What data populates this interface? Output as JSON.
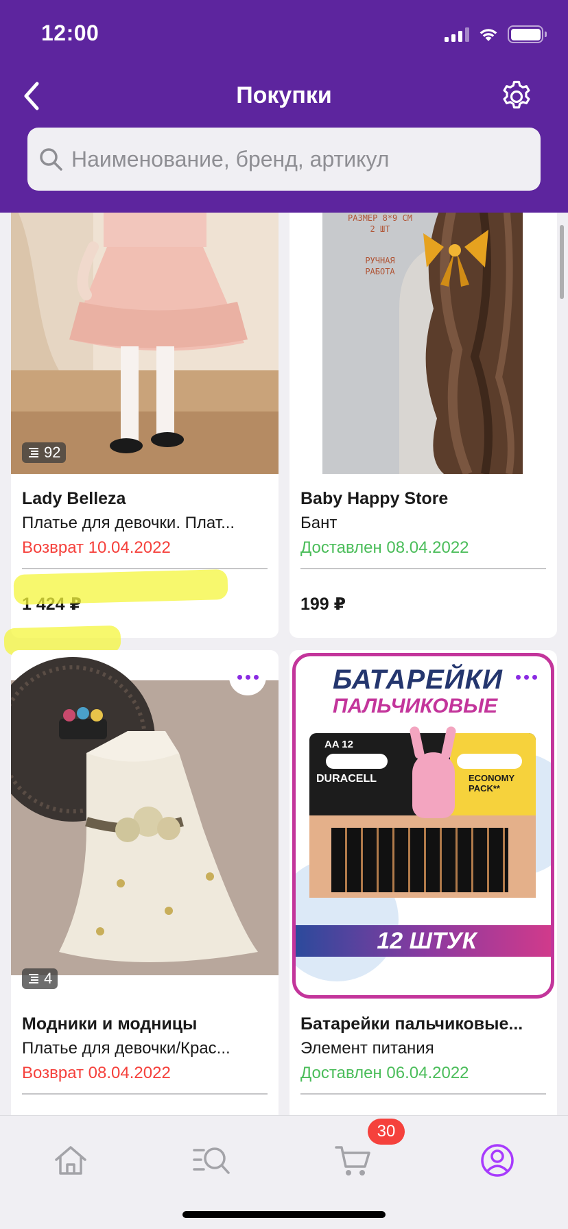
{
  "status_bar": {
    "time": "12:00"
  },
  "nav": {
    "title": "Покупки"
  },
  "search": {
    "placeholder": "Наименование, бренд, артикул"
  },
  "products": [
    {
      "brand": "Lady Belleza",
      "name": "Платье для девочки. Плат...",
      "status": "Возврат 10.04.2022",
      "status_type": "return",
      "price": "1 424 ₽",
      "photo_count": "92"
    },
    {
      "brand": "Baby Happy Store",
      "name": "Бант",
      "status": "Доставлен 08.04.2022",
      "status_type": "delivered",
      "price": "199 ₽",
      "image_text": [
        "РАЗМЕР 8*9 СМ",
        "2 ШТ",
        "РУЧНАЯ",
        "РАБОТА"
      ]
    },
    {
      "brand": "Модники и модницы",
      "name": "Платье для девочки/Крас...",
      "status": "Возврат 08.04.2022",
      "status_type": "return",
      "photo_count": "4"
    },
    {
      "brand": "Батарейки пальчиковые...",
      "name": "Элемент питания",
      "status": "Доставлен 06.04.2022",
      "status_type": "delivered",
      "image_text": {
        "title_line1": "БАТАРЕЙКИ",
        "title_line2": "ПАЛЬЧИКОВЫЕ",
        "size": "AA 12",
        "brand": "DURACELL",
        "pack": "ECONOMY PACK**",
        "count": "12 ШТУК"
      }
    }
  ],
  "tabbar": {
    "tabs": [
      {
        "icon": "home-icon"
      },
      {
        "icon": "catalog-search-icon"
      },
      {
        "icon": "cart-icon"
      },
      {
        "icon": "profile-icon"
      }
    ],
    "cart_badge": "30",
    "active_color": "#a73afd"
  },
  "colors": {
    "header": "#5d259e",
    "return": "#f5413c",
    "delivered": "#4bbd5a",
    "highlight": "#f4f63c"
  }
}
